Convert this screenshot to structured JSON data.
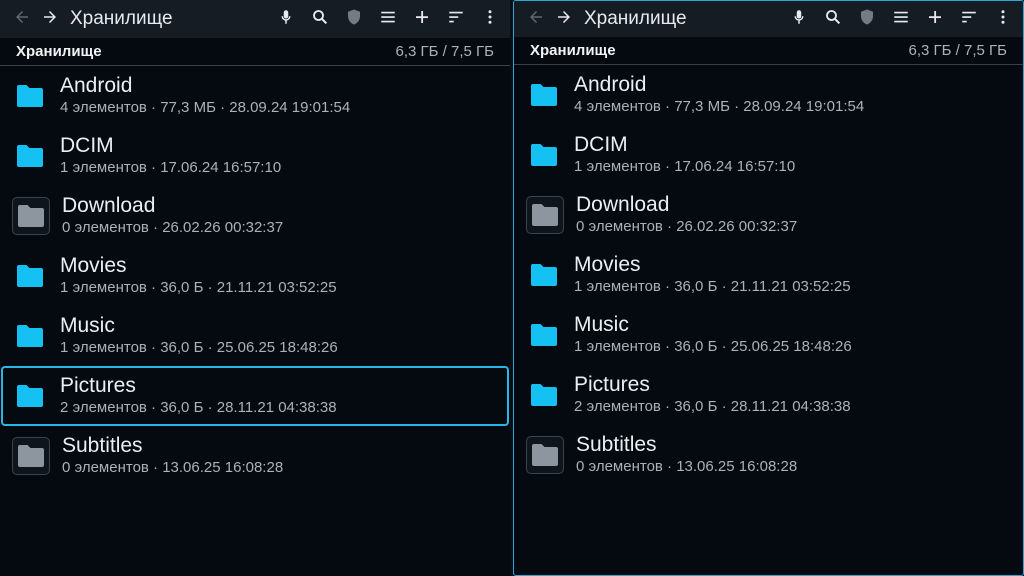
{
  "colors": {
    "accent": "#29b6e6",
    "folder_blue": "#15c0f2",
    "folder_gray": "#8d959e",
    "background": "#050a10",
    "toolbar": "#161c24"
  },
  "panes": [
    {
      "title": "Хранилище",
      "storage_label": "Хранилище",
      "storage_usage": "6,3 ГБ / 7,5 ГБ",
      "active": false,
      "icons": [
        "back-arrow-icon",
        "forward-arrow-icon",
        "microphone-icon",
        "search-icon",
        "shield-icon",
        "list-view-icon",
        "add-icon",
        "sort-icon",
        "more-vert-icon"
      ],
      "items": [
        {
          "name": "Android",
          "meta": "4 элементов · 77,3 МБ · 28.09.24 19:01:54",
          "icon": "folder-icon",
          "color": "blue"
        },
        {
          "name": "DCIM",
          "meta": "1 элементов · 17.06.24 16:57:10",
          "icon": "folder-icon",
          "color": "blue"
        },
        {
          "name": "Download",
          "meta": "0 элементов · 26.02.26 00:32:37",
          "icon": "folder-empty-icon",
          "color": "gray"
        },
        {
          "name": "Movies",
          "meta": "1 элементов · 36,0 Б · 21.11.21 03:52:25",
          "icon": "folder-icon",
          "color": "blue"
        },
        {
          "name": "Music",
          "meta": "1 элементов · 36,0 Б · 25.06.25 18:48:26",
          "icon": "folder-icon",
          "color": "blue"
        },
        {
          "name": "Pictures",
          "meta": "2 элементов · 36,0 Б · 28.11.21 04:38:38",
          "icon": "folder-icon",
          "color": "blue",
          "focused": true
        },
        {
          "name": "Subtitles",
          "meta": "0 элементов · 13.06.25 16:08:28",
          "icon": "folder-empty-icon",
          "color": "gray"
        }
      ]
    },
    {
      "title": "Хранилище",
      "storage_label": "Хранилище",
      "storage_usage": "6,3 ГБ / 7,5 ГБ",
      "active": true,
      "icons": [
        "back-arrow-icon",
        "forward-arrow-icon",
        "microphone-icon",
        "search-icon",
        "shield-icon",
        "list-view-icon",
        "add-icon",
        "sort-icon",
        "more-vert-icon"
      ],
      "items": [
        {
          "name": "Android",
          "meta": "4 элементов · 77,3 МБ · 28.09.24 19:01:54",
          "icon": "folder-icon",
          "color": "blue"
        },
        {
          "name": "DCIM",
          "meta": "1 элементов · 17.06.24 16:57:10",
          "icon": "folder-icon",
          "color": "blue"
        },
        {
          "name": "Download",
          "meta": "0 элементов · 26.02.26 00:32:37",
          "icon": "folder-empty-icon",
          "color": "gray"
        },
        {
          "name": "Movies",
          "meta": "1 элементов · 36,0 Б · 21.11.21 03:52:25",
          "icon": "folder-icon",
          "color": "blue"
        },
        {
          "name": "Music",
          "meta": "1 элементов · 36,0 Б · 25.06.25 18:48:26",
          "icon": "folder-icon",
          "color": "blue"
        },
        {
          "name": "Pictures",
          "meta": "2 элементов · 36,0 Б · 28.11.21 04:38:38",
          "icon": "folder-icon",
          "color": "blue"
        },
        {
          "name": "Subtitles",
          "meta": "0 элементов · 13.06.25 16:08:28",
          "icon": "folder-empty-icon",
          "color": "gray"
        }
      ]
    }
  ]
}
